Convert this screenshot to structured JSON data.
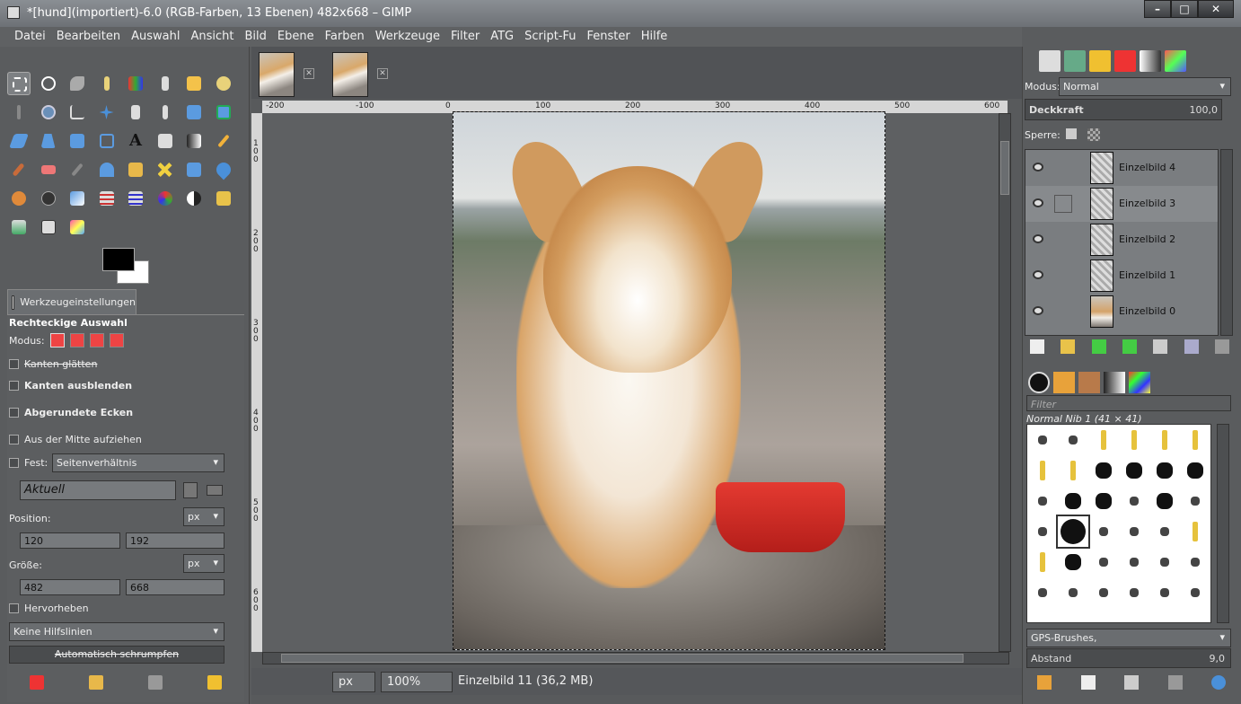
{
  "window": {
    "title": "*[hund](importiert)-6.0 (RGB-Farben, 13 Ebenen) 482x668 – GIMP"
  },
  "menu": [
    "Datei",
    "Bearbeiten",
    "Auswahl",
    "Ansicht",
    "Bild",
    "Ebene",
    "Farben",
    "Werkzeuge",
    "Filter",
    "ATG",
    "Script-Fu",
    "Fenster",
    "Hilfe"
  ],
  "tool_options": {
    "tab_label": "Werkzeugeinstellungen",
    "title": "Rechteckige Auswahl",
    "mode_label": "Modus:",
    "antialias": "Kanten glätten",
    "feather": "Kanten ausblenden",
    "rounded": "Abgerundete Ecken",
    "expand_center": "Aus der Mitte aufziehen",
    "fixed_label": "Fest:",
    "fixed_value": "Seitenverhältnis",
    "aspect_value": "Aktuell",
    "position_label": "Position:",
    "position_unit": "px",
    "pos_x": "120",
    "pos_y": "192",
    "size_label": "Größe:",
    "size_unit": "px",
    "size_w": "482",
    "size_h": "668",
    "highlight": "Hervorheben",
    "guides": "Keine Hilfslinien",
    "autoshrink": "Automatisch schrumpfen"
  },
  "ruler_h": [
    "-200",
    "-100",
    "0",
    "100",
    "200",
    "300",
    "400",
    "500",
    "600"
  ],
  "ruler_v": [
    "100",
    "200",
    "300",
    "400",
    "500",
    "600"
  ],
  "status": {
    "unit": "px",
    "zoom": "100%",
    "info": "Einzelbild 11 (36,2 MB)"
  },
  "layers_panel": {
    "mode_label": "Modus:",
    "mode_value": "Normal",
    "opacity_label": "Deckkraft",
    "opacity_value": "100,0",
    "lock_label": "Sperre:",
    "layers": [
      "Einzelbild 4",
      "Einzelbild 3",
      "Einzelbild 2",
      "Einzelbild 1",
      "Einzelbild 0"
    ]
  },
  "brushes_panel": {
    "filter_placeholder": "Filter",
    "brush_name": "Normal Nib 1 (41 × 41)",
    "set": "GPS-Brushes,",
    "spacing_label": "Abstand",
    "spacing_value": "9,0"
  }
}
